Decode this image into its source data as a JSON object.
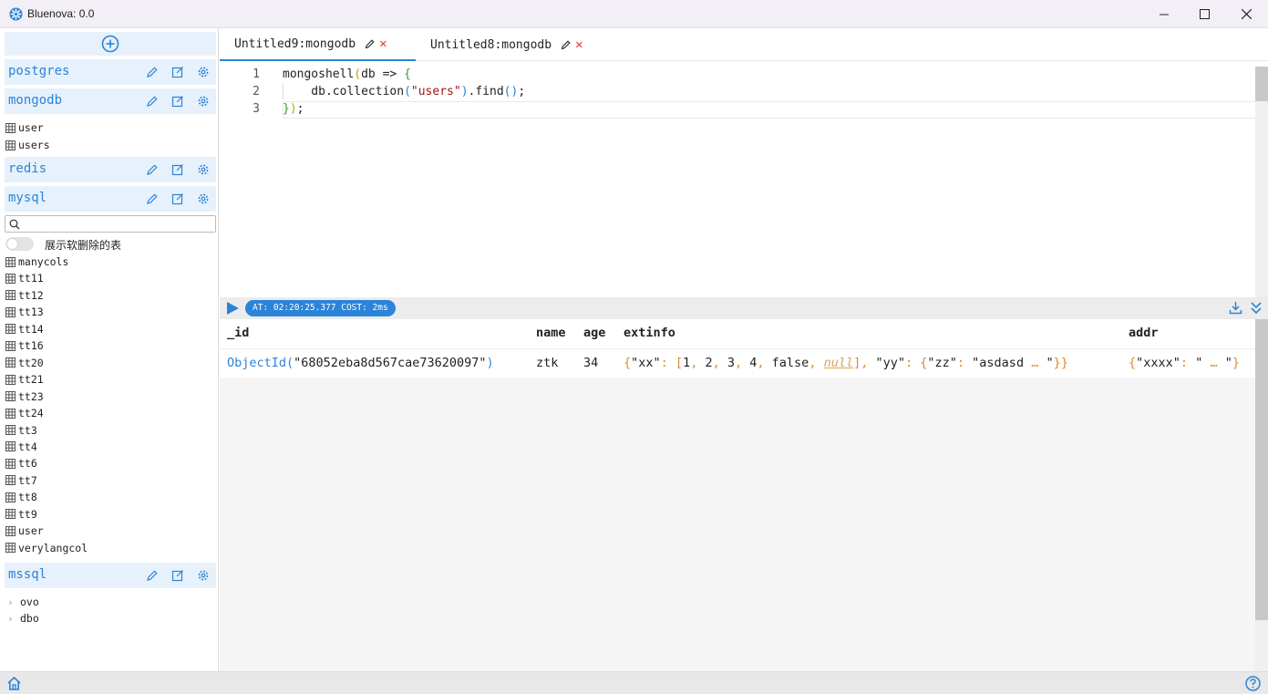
{
  "window": {
    "title": "Bluenova: 0.0"
  },
  "sidebar": {
    "connections": [
      {
        "name": "postgres"
      },
      {
        "name": "mongodb",
        "tables": [
          "user",
          "users"
        ]
      },
      {
        "name": "redis"
      },
      {
        "name": "mysql",
        "search_placeholder": "",
        "toggle_label": "展示软删除的表",
        "tables": [
          "manycols",
          "tt11",
          "tt12",
          "tt13",
          "tt14",
          "tt16",
          "tt20",
          "tt21",
          "tt23",
          "tt24",
          "tt3",
          "tt4",
          "tt6",
          "tt7",
          "tt8",
          "tt9",
          "user",
          "verylangcol"
        ]
      },
      {
        "name": "mssql",
        "schemas": [
          "ovo",
          "dbo"
        ]
      }
    ]
  },
  "tabs": [
    {
      "label": "Untitled9:mongodb",
      "active": true
    },
    {
      "label": "Untitled8:mongodb",
      "active": false
    }
  ],
  "editor": {
    "line_numbers": [
      "1",
      "2",
      "3"
    ]
  },
  "result": {
    "status": "AT: 02:20:25.377 COST: 2ms",
    "columns": [
      "_id",
      "name",
      "age",
      "extinfo",
      "addr"
    ],
    "row": {
      "id_fn": "ObjectId",
      "id_value": "\"68052eba8d567cae73620097\"",
      "name": "ztk",
      "age": "34"
    }
  },
  "colors": {
    "accent": "#2b84d8",
    "header_bg": "#e6f1fb",
    "close": "#e53935",
    "bracket_orange": "#e08a2c"
  }
}
